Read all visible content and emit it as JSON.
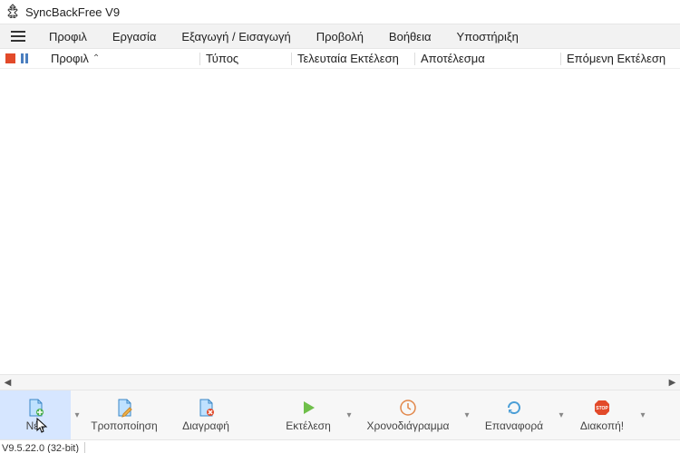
{
  "title": "SyncBackFree V9",
  "menu": [
    "Προφιλ",
    "Εργασία",
    "Εξαγωγή / Εισαγωγή",
    "Προβολή",
    "Βοήθεια",
    "Υποστήριξη"
  ],
  "columns": {
    "c0": "Προφιλ",
    "c1": "Τύπος",
    "c2": "Τελευταία Εκτέλεση",
    "c3": "Αποτέλεσμα",
    "c4": "Επόμενη Εκτέλεση",
    "sort": "⌃"
  },
  "toolbar": {
    "new": "Νέο",
    "modify": "Τροποποίηση",
    "delete": "Διαγραφή",
    "run": "Εκτέλεση",
    "schedule": "Χρονοδιάγραμμα",
    "restore": "Επαναφορά",
    "stop": "Διακοπή!"
  },
  "status": {
    "version": "V9.5.22.0 (32-bit)"
  }
}
